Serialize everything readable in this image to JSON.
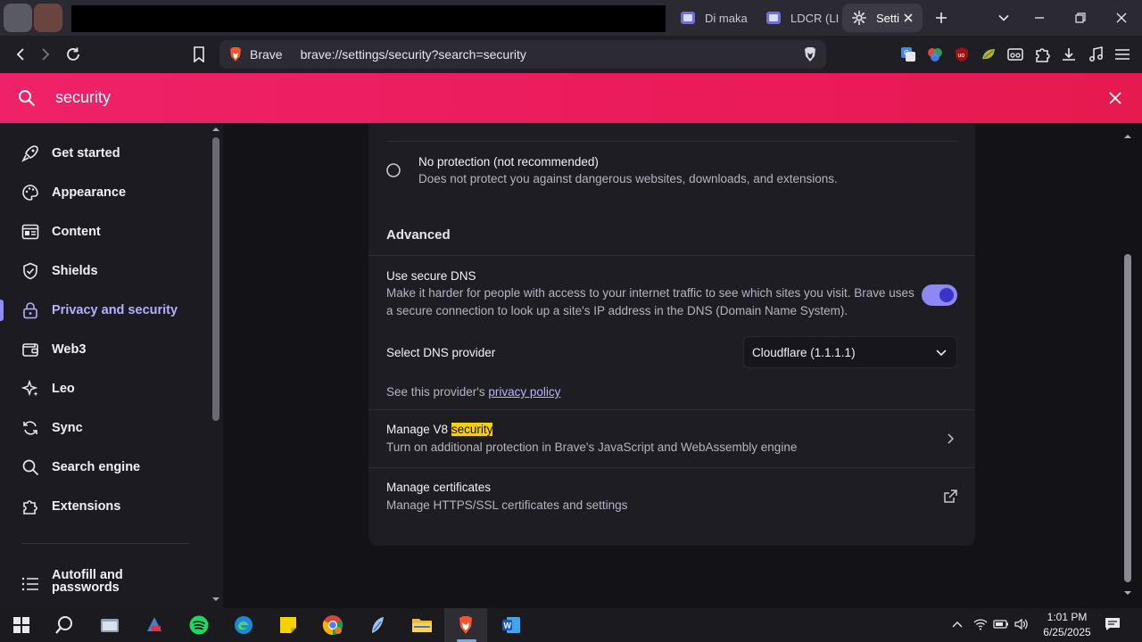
{
  "tabs": [
    {
      "label": "Di maka",
      "active": false
    },
    {
      "label": "LDCR (LI",
      "active": false
    },
    {
      "label": "Setti",
      "active": true
    }
  ],
  "toolbar": {
    "site_label": "Brave",
    "url": "brave://settings/security?search=security"
  },
  "search": {
    "query": "security"
  },
  "sidebar": {
    "items": [
      {
        "label": "Get started",
        "icon": "rocket-icon"
      },
      {
        "label": "Appearance",
        "icon": "palette-icon"
      },
      {
        "label": "Content",
        "icon": "content-icon"
      },
      {
        "label": "Shields",
        "icon": "shield-icon"
      },
      {
        "label": "Privacy and security",
        "icon": "lock-icon",
        "active": true
      },
      {
        "label": "Web3",
        "icon": "wallet-icon"
      },
      {
        "label": "Leo",
        "icon": "leo-star-icon"
      },
      {
        "label": "Sync",
        "icon": "sync-icon"
      },
      {
        "label": "Search engine",
        "icon": "search-icon"
      },
      {
        "label": "Extensions",
        "icon": "puzzle-icon"
      }
    ],
    "autofill": {
      "line1": "Autofill and",
      "line2": "passwords",
      "icon": "list-icon"
    }
  },
  "content": {
    "no_protection": {
      "title": "No protection (not recommended)",
      "desc": "Does not protect you against dangerous websites, downloads, and extensions."
    },
    "advanced_heading": "Advanced",
    "secure_dns": {
      "title": "Use secure DNS",
      "desc": "Make it harder for people with access to your internet traffic to see which sites you visit. Brave uses a secure connection to look up a site's IP address in the DNS (Domain Name System).",
      "enabled": true
    },
    "dns_provider": {
      "label": "Select DNS provider",
      "value": "Cloudflare (1.1.1.1)"
    },
    "provider_policy": {
      "prefix": "See this provider's ",
      "link": "privacy policy"
    },
    "v8": {
      "title_prefix": "Manage V8 ",
      "title_highlight": "security",
      "desc": "Turn on additional protection in Brave's JavaScript and WebAssembly engine"
    },
    "certificates": {
      "title": "Manage certificates",
      "desc": "Manage HTTPS/SSL certificates and settings"
    }
  },
  "taskbar": {
    "time": "1:01 PM",
    "date": "6/25/2025"
  },
  "colors": {
    "accent": "#5a54e8",
    "search_bar": "#ee1f63",
    "highlight": "#fad000",
    "link": "#b7b3ff"
  }
}
